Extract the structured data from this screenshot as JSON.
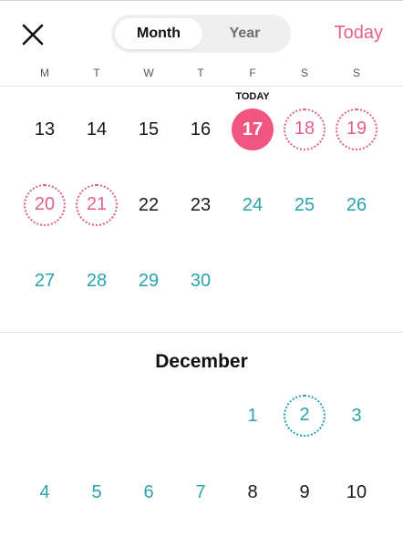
{
  "header": {
    "close_icon": "close-icon",
    "segment": {
      "month_label": "Month",
      "year_label": "Year",
      "selected": "Month"
    },
    "today_button_label": "Today",
    "accent_color": "#e8608a"
  },
  "weekdays": [
    "M",
    "T",
    "W",
    "T",
    "F",
    "S",
    "S"
  ],
  "today_label": "TODAY",
  "current_month": {
    "weeks": [
      [
        "13",
        "14",
        "15",
        "16",
        "17",
        "18",
        "19"
      ],
      [
        "20",
        "21",
        "22",
        "23",
        "24",
        "25",
        "26"
      ],
      [
        "27",
        "28",
        "29",
        "30"
      ]
    ],
    "today": "17",
    "highlighted": [
      "18",
      "19",
      "20",
      "21"
    ]
  },
  "next_month": {
    "name": "December",
    "weeks": [
      [
        "1",
        "2",
        "3"
      ],
      [
        "4",
        "5",
        "6",
        "7",
        "8",
        "9",
        "10"
      ]
    ],
    "highlighted": [
      "2"
    ]
  },
  "colors": {
    "today_fill": "#f0567f",
    "future_day": "#2aa3aa",
    "highlight_ring": "#e0628b"
  }
}
